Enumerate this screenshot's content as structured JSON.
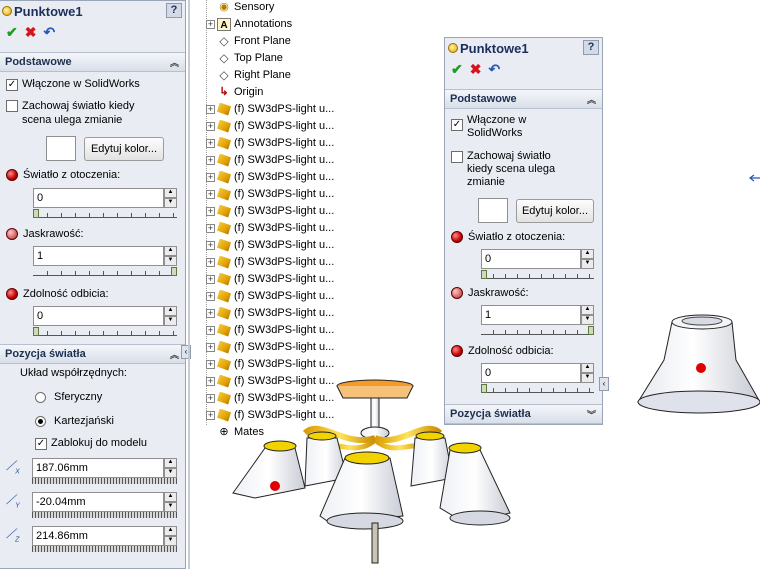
{
  "left_panel": {
    "title": "Punktowe1",
    "help": "?",
    "actions": {
      "ok": "✔",
      "cancel": "✖",
      "undo": "↶"
    },
    "basic": {
      "header": "Podstawowe",
      "enabled_label": "Włączone w SolidWorks",
      "enabled_mark": "✓",
      "keep_light_label_1": "Zachowaj światło kiedy",
      "keep_light_label_2": "scena ulega zmianie",
      "edit_color": "Edytuj kolor...",
      "ambient_label": "Światło z otoczenia:",
      "ambient_value": "0",
      "brightness_label": "Jaskrawość:",
      "brightness_value": "1",
      "specular_label": "Zdolność odbicia:",
      "specular_value": "0"
    },
    "position": {
      "header": "Pozycja światła",
      "coord_system_label": "Układ współrzędnych:",
      "spherical": "Sferyczny",
      "cartesian": "Kartezjański",
      "lock_label": "Zablokuj do modelu",
      "lock_mark": "✓",
      "x_value": "187.06mm",
      "y_value": "-20.04mm",
      "z_value": "214.86mm",
      "x_axis": "X",
      "y_axis": "Y",
      "z_axis": "Z"
    }
  },
  "tree": {
    "items": [
      {
        "label": "Sensory",
        "icon": "sensor-icon",
        "expand": false
      },
      {
        "label": "Annotations",
        "icon": "annotation-icon",
        "expand": true
      },
      {
        "label": "Front Plane",
        "icon": "plane-icon",
        "expand": false
      },
      {
        "label": "Top Plane",
        "icon": "plane-icon",
        "expand": false
      },
      {
        "label": "Right Plane",
        "icon": "plane-icon",
        "expand": false
      },
      {
        "label": "Origin",
        "icon": "origin-icon",
        "expand": false
      },
      {
        "label": "(f) SW3dPS-light u...",
        "icon": "light-part-icon",
        "expand": true
      },
      {
        "label": "(f) SW3dPS-light u...",
        "icon": "light-part-icon",
        "expand": true
      },
      {
        "label": "(f) SW3dPS-light u...",
        "icon": "light-part-icon",
        "expand": true
      },
      {
        "label": "(f) SW3dPS-light u...",
        "icon": "light-part-icon",
        "expand": true
      },
      {
        "label": "(f) SW3dPS-light u...",
        "icon": "light-part-icon",
        "expand": true
      },
      {
        "label": "(f) SW3dPS-light u...",
        "icon": "light-part-icon",
        "expand": true
      },
      {
        "label": "(f) SW3dPS-light u...",
        "icon": "light-part-icon",
        "expand": true
      },
      {
        "label": "(f) SW3dPS-light u...",
        "icon": "light-part-icon",
        "expand": true
      },
      {
        "label": "(f) SW3dPS-light u...",
        "icon": "light-part-icon",
        "expand": true
      },
      {
        "label": "(f) SW3dPS-light u...",
        "icon": "light-part-icon",
        "expand": true
      },
      {
        "label": "(f) SW3dPS-light u...",
        "icon": "light-part-icon",
        "expand": true
      },
      {
        "label": "(f) SW3dPS-light u...",
        "icon": "light-part-icon",
        "expand": true
      },
      {
        "label": "(f) SW3dPS-light u...",
        "icon": "light-part-icon",
        "expand": true
      },
      {
        "label": "(f) SW3dPS-light u...",
        "icon": "light-part-icon",
        "expand": true
      },
      {
        "label": "(f) SW3dPS-light u...",
        "icon": "light-part-icon",
        "expand": true
      },
      {
        "label": "(f) SW3dPS-light u...",
        "icon": "light-part-icon",
        "expand": true
      },
      {
        "label": "(f) SW3dPS-light u...",
        "icon": "light-part-icon",
        "expand": true
      },
      {
        "label": "(f) SW3dPS-light u...",
        "icon": "light-part-icon",
        "expand": true
      },
      {
        "label": "(f) SW3dPS-light u...",
        "icon": "light-part-icon",
        "expand": true
      },
      {
        "label": "Mates",
        "icon": "mates-icon",
        "expand": false
      }
    ]
  },
  "right_panel": {
    "title": "Punktowe1",
    "help": "?",
    "actions": {
      "ok": "✔",
      "cancel": "✖",
      "undo": "↶"
    },
    "basic": {
      "header": "Podstawowe",
      "enabled_label_1": "Włączone w",
      "enabled_label_2": "SolidWorks",
      "enabled_mark": "✓",
      "keep_light_label_1": "Zachowaj światło",
      "keep_light_label_2": "kiedy scena ulega",
      "keep_light_label_3": "zmianie",
      "edit_color": "Edytuj kolor...",
      "ambient_label": "Światło z otoczenia:",
      "ambient_value": "0",
      "brightness_label": "Jaskrawość:",
      "brightness_value": "1",
      "specular_label": "Zdolność odbicia:",
      "specular_value": "0"
    },
    "position_header": "Pozycja światła"
  },
  "colors": {
    "panel_bg": "#e9edf3",
    "header_text": "#1e3050",
    "light_red": "#c40000",
    "ok_green": "#1f9b22",
    "cancel_red": "#d8131b"
  }
}
